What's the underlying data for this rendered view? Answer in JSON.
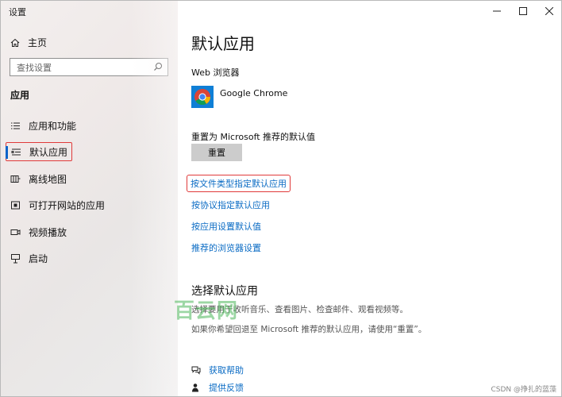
{
  "window": {
    "title": "设置",
    "controls": {
      "minimize": "minimize",
      "maximize": "maximize",
      "close": "close"
    }
  },
  "sidebar": {
    "home_label": "主页",
    "search_placeholder": "查找设置",
    "section_label": "应用",
    "items": [
      {
        "label": "应用和功能",
        "icon": "apps-list-icon"
      },
      {
        "label": "默认应用",
        "icon": "default-apps-icon",
        "active": true
      },
      {
        "label": "离线地图",
        "icon": "offline-maps-icon"
      },
      {
        "label": "可打开网站的应用",
        "icon": "apps-for-websites-icon"
      },
      {
        "label": "视频播放",
        "icon": "video-playback-icon"
      },
      {
        "label": "启动",
        "icon": "startup-icon"
      }
    ]
  },
  "main": {
    "title": "默认应用",
    "browser_label": "Web 浏览器",
    "browser_name": "Google Chrome",
    "reset_label": "重置为 Microsoft 推荐的默认值",
    "reset_button": "重置",
    "links": [
      "按文件类型指定默认应用",
      "按协议指定默认应用",
      "按应用设置默认值",
      "推荐的浏览器设置"
    ],
    "choose_title": "选择默认应用",
    "choose_desc1": "选择要用于收听音乐、查看图片、检查邮件、观看视频等。",
    "choose_desc2": "如果你希望回退至 Microsoft 推荐的默认应用，请使用“重置”。",
    "help_label": "获取帮助",
    "feedback_label": "提供反馈"
  },
  "watermark": {
    "logo_text": "百云网",
    "credit": "CSDN @挣扎的蓝藻"
  },
  "colors": {
    "accent": "#0a63c9",
    "link": "#0a6bc4",
    "highlight_box": "#e03a3a",
    "chrome_tile": "#0f7fd6"
  }
}
